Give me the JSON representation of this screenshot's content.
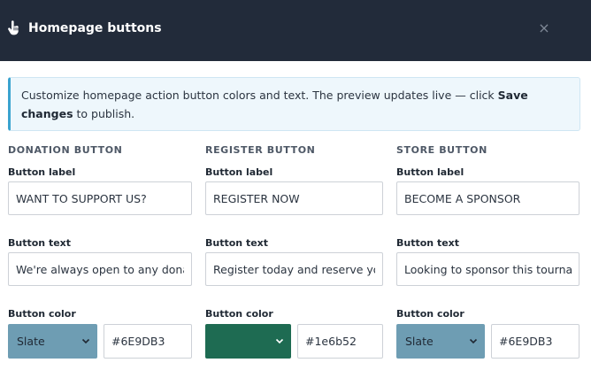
{
  "modal": {
    "title": "Homepage buttons",
    "close_glyph": "×"
  },
  "info": {
    "text_before": "Customize homepage action button colors and text. The preview updates live — click ",
    "bold": "Save changes",
    "text_after": " to publish."
  },
  "labels": {
    "button_label": "Button label",
    "button_text": "Button text",
    "button_color": "Button color"
  },
  "sections": [
    {
      "heading": "DONATION BUTTON",
      "label_value": "WANT TO SUPPORT US?",
      "text_value": "We're always open to any donati",
      "color_name": "Slate",
      "color_hex": "#6E9DB3"
    },
    {
      "heading": "REGISTER BUTTON",
      "label_value": "REGISTER NOW",
      "text_value": "Register today and reserve your",
      "color_name": "",
      "color_hex": "#1e6b52"
    },
    {
      "heading": "STORE BUTTON",
      "label_value": "BECOME A SPONSOR",
      "text_value": "Looking to sponsor this tournam",
      "color_name": "Slate",
      "color_hex": "#6E9DB3"
    }
  ],
  "colors": {
    "header_bg": "#222b3a",
    "info_accent": "#3aa3cf",
    "slate": "#6E9DB3",
    "green": "#1e6b52"
  },
  "icons": {
    "hand": "pointing-hand-icon",
    "close": "close-icon",
    "chevron": "chevron-down-icon"
  }
}
